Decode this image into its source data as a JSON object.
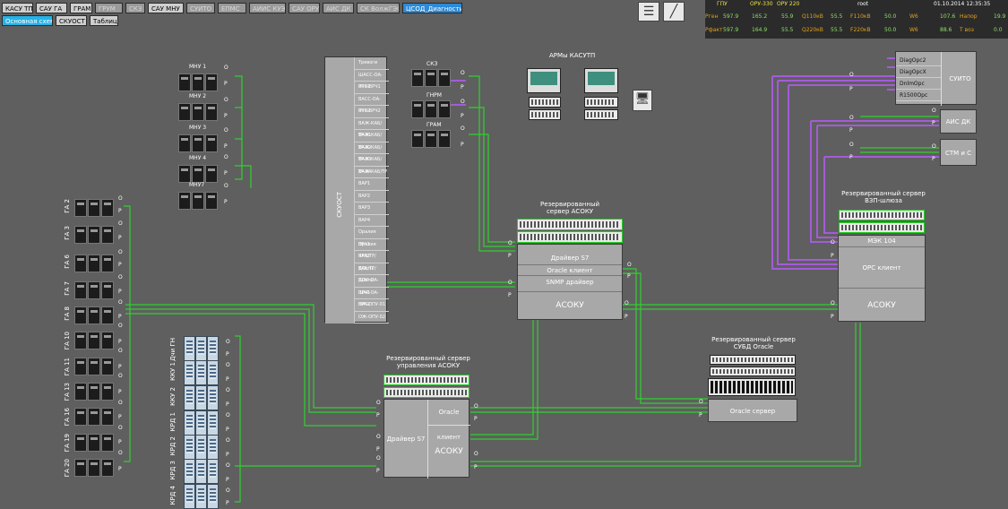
{
  "toolbar": {
    "row1": [
      "КАСУ ТП",
      "САУ ГА",
      "ГРАМ",
      "ГРУМ",
      "СКЗ",
      "САУ МНУ",
      "СУИТО",
      "ЕПМС",
      "АИИС КУЭ",
      "САУ ОРУ",
      "АИС ДК",
      "СК ВолжГЭС",
      "ЦСОД_Диагностика"
    ],
    "row2": [
      "Основная схема",
      "СКУОСТ",
      "Таблица"
    ]
  },
  "status_table": {
    "headers": [
      "",
      "ГПУ",
      "ОРУ-330",
      "ОРУ 220",
      "",
      "",
      "",
      "",
      "",
      "",
      "root",
      "",
      "01.10.2014 12:35:35",
      ""
    ],
    "row1": {
      "label": "Pген",
      "v1": "597.9",
      "v2": "165.2",
      "v3": "55.9",
      "k1": "Q110кВ",
      "v4": "55.5",
      "k2": "F110кВ",
      "v5": "50.0",
      "k3": "W6",
      "v6": "107.6",
      "k4": "Напор",
      "v7": "19.9"
    },
    "row2": {
      "label": "Pфакт",
      "v1": "597.9",
      "v2": "164.9",
      "v3": "55.5",
      "k1": "Q220кВ",
      "v4": "55.5",
      "k2": "F220кВ",
      "v5": "50.0",
      "k3": "W6",
      "v6": "88.6",
      "k4": "Т воз",
      "v7": "0.0"
    }
  },
  "units_mnu": [
    "МНУ 1",
    "МНУ 2",
    "МНУ 3",
    "МНУ 4",
    "МНУ7"
  ],
  "units_ga": [
    "ГА 2",
    "ГА 3",
    "ГА 6",
    "ГА 7",
    "ГА 8",
    "ГА 10",
    "ГА 11",
    "ГА 13",
    "ГА 16",
    "ГА 19",
    "ГА 20"
  ],
  "units_kku": [
    "Дчи ГН",
    "ККУ 1",
    "ККУ 2",
    "КРД 1",
    "КРД 2",
    "КРД 3",
    "КРД 4"
  ],
  "skz": [
    "СКЗ",
    "ГНРМ",
    "ГРАМ"
  ],
  "skuost": {
    "title": "СКУОСТ",
    "rows": [
      "Тревоги",
      "ШАСС-ОА-ВРЧ1",
      "РЧБ-ВРЧ1",
      "ВАСС-ОА-ВРЧ2",
      "РЧБ-ВРЧ2",
      "ВАЖ-КАБ/ТР-01",
      "ВАЖ-КАБ/ТР-02",
      "ВАЖ-КАБ/ТР-03",
      "ВАЖ-КАБ/ТР-04",
      "ВАЖ-КАБ/ТР",
      "ВАР1",
      "ВАР2",
      "ВАР3",
      "ВАР4",
      "Оралия ВРЧ1",
      "Оралия ВРЧ2",
      "КАБ/ТР/ДОсп1",
      "КАБ/ТР/ДОсп2",
      "ШАР-ОА-ВРЧ1",
      "ШАР-ОА-ВРЧ2",
      "ОЖ-ОПУ-01",
      "ОЖ-ОПУ-02"
    ]
  },
  "arms": {
    "title": "АРМы КАСУТП"
  },
  "asoku_main": {
    "title": "Резервированный сервер АСОКУ",
    "rows": [
      "Драйвер S7",
      "Oracle клиент",
      "SNMP драйвер",
      "АСОКУ"
    ]
  },
  "asoku_control": {
    "title": "Резервированный сервер управления АСОКУ",
    "left": "Драйвер S7",
    "right_top": "Oracle клиент",
    "right_bottom": "АСОКУ"
  },
  "oracle": {
    "title": "Резервированный сервер СУБД Oracle",
    "row": "Oracle сервер"
  },
  "vzp": {
    "title": "Резервированный сервер ВЗП-шлюза",
    "rows": [
      "МЭК 104",
      "OPC клиент",
      "АСОКУ"
    ]
  },
  "sumto": {
    "label": "СУИТО",
    "rows": [
      "DiagOpc2",
      "DiagOpcX",
      "DnlmOpc",
      "R1500Opc"
    ]
  },
  "ais_dk": "АИС ДК",
  "stm": "СТМ и С",
  "port_o": "О",
  "port_p": "Р",
  "colors": {
    "bg": "#5f5f5f",
    "line": "#2fd12f",
    "link2": "#a45bd8",
    "accent": "#27b2e6"
  }
}
